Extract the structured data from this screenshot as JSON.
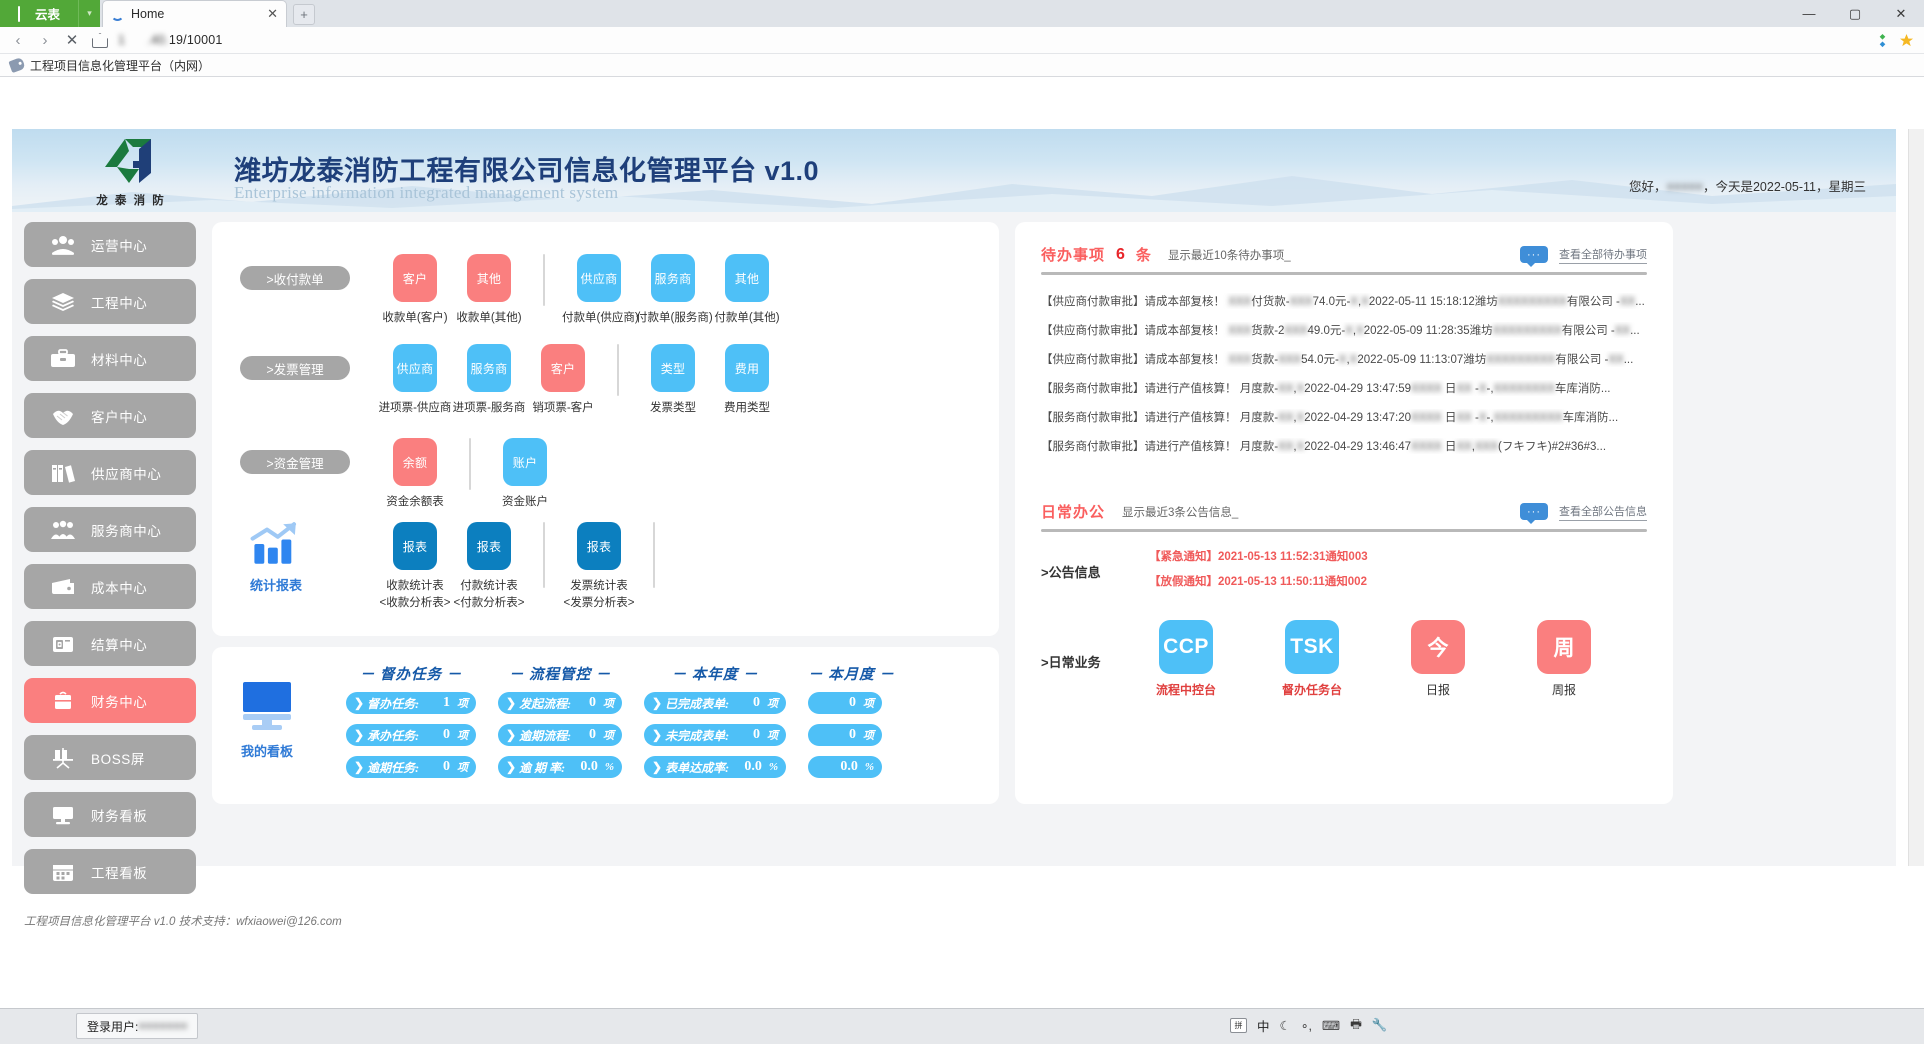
{
  "browser": {
    "brand": "云表",
    "tab_title": "Home",
    "tab_close": "✕",
    "newtab": "+",
    "url": "1      .40.19/10001",
    "bookmark": "工程项目信息化管理平台（内网）",
    "win_minimize": "—",
    "win_maximize": "▢",
    "win_close": "✕"
  },
  "banner": {
    "title": "潍坊龙泰消防工程有限公司信息化管理平台 v1.0",
    "subtitle": "Enterprise information integrated management system",
    "logo_sub": "龙 泰 消 防",
    "greeting_prefix": "您好，",
    "greeting_user": "×××××",
    "greeting_suffix": "，今天是2022-05-11，星期三"
  },
  "sidebar": {
    "items": [
      {
        "label": "运营中心",
        "icon": "team-icon",
        "active": false
      },
      {
        "label": "工程中心",
        "icon": "layers-icon",
        "active": false
      },
      {
        "label": "材料中心",
        "icon": "toolbox-icon",
        "active": false
      },
      {
        "label": "客户中心",
        "icon": "handshake-icon",
        "active": false
      },
      {
        "label": "供应商中心",
        "icon": "books-icon",
        "active": false
      },
      {
        "label": "服务商中心",
        "icon": "people-icon",
        "active": false
      },
      {
        "label": "成本中心",
        "icon": "wallet-icon",
        "active": false
      },
      {
        "label": "结算中心",
        "icon": "card-icon",
        "active": false
      },
      {
        "label": "财务中心",
        "icon": "briefcase-icon",
        "active": true
      },
      {
        "label": "BOSS屏",
        "icon": "presentation-icon",
        "active": false
      },
      {
        "label": "财务看板",
        "icon": "monitor-icon",
        "active": false
      },
      {
        "label": "工程看板",
        "icon": "calendar-icon",
        "active": false
      }
    ]
  },
  "main": {
    "groups": [
      {
        "pill": ">收付款单",
        "tiles": [
          {
            "badge": "客户",
            "color": "red",
            "label": "收款单(客户)"
          },
          {
            "badge": "其他",
            "color": "red",
            "label": "收款单(其他)"
          },
          {
            "divider": true
          },
          {
            "badge": "供应商",
            "color": "blue",
            "label": "付款单(供应商)"
          },
          {
            "badge": "服务商",
            "color": "blue",
            "label": "付款单(服务商)"
          },
          {
            "badge": "其他",
            "color": "blue",
            "label": "付款单(其他)"
          }
        ]
      },
      {
        "pill": ">发票管理",
        "tiles": [
          {
            "badge": "供应商",
            "color": "blue",
            "label": "进项票-供应商"
          },
          {
            "badge": "服务商",
            "color": "blue",
            "label": "进项票-服务商"
          },
          {
            "badge": "客户",
            "color": "red",
            "label": "销项票-客户"
          },
          {
            "divider": true
          },
          {
            "badge": "类型",
            "color": "blue",
            "label": "发票类型"
          },
          {
            "badge": "费用",
            "color": "blue",
            "label": "费用类型"
          }
        ]
      },
      {
        "pill": ">资金管理",
        "tiles": [
          {
            "badge": "余额",
            "color": "red",
            "label": "资金余额表"
          },
          {
            "divider": true
          },
          {
            "badge": "账户",
            "color": "blue",
            "label": "资金账户"
          }
        ]
      }
    ],
    "report": {
      "left_label": "统计报表",
      "tiles": [
        {
          "badge": "报表",
          "color": "dblue",
          "label": "收款统计表",
          "label2": "<收款分析表>"
        },
        {
          "badge": "报表",
          "color": "dblue",
          "label": "付款统计表",
          "label2": "<付款分析表>"
        },
        {
          "divider": true
        },
        {
          "badge": "报表",
          "color": "dblue",
          "label": "发票统计表",
          "label2": "<发票分析表>"
        },
        {
          "divider": true
        }
      ]
    }
  },
  "board": {
    "left_label": "我的看板",
    "columns": [
      {
        "head": "－ 督办任务 －",
        "rows": [
          {
            "label": "督办任务:",
            "value": "1",
            "unit": "项"
          },
          {
            "label": "承办任务:",
            "value": "0",
            "unit": "项"
          },
          {
            "label": "逾期任务:",
            "value": "0",
            "unit": "项"
          }
        ]
      },
      {
        "head": "－ 流程管控 －",
        "rows": [
          {
            "label": "发起流程:",
            "value": "0",
            "unit": "项"
          },
          {
            "label": "逾期流程:",
            "value": "0",
            "unit": "项"
          },
          {
            "label": "逾 期 率:",
            "value": "0.0",
            "unit": "%"
          }
        ]
      },
      {
        "head": "－ 本年度 －",
        "rows": [
          {
            "label": "已完成表单:",
            "value": "0",
            "unit": "项"
          },
          {
            "label": "未完成表单:",
            "value": "0",
            "unit": "项"
          },
          {
            "label": "表单达成率:",
            "value": "0.0",
            "unit": "%"
          }
        ]
      },
      {
        "head": "－ 本月度 －",
        "rows": [
          {
            "value": "0",
            "unit": "项"
          },
          {
            "value": "0",
            "unit": "项"
          },
          {
            "value": "0.0",
            "unit": "%"
          }
        ]
      }
    ]
  },
  "right": {
    "todo": {
      "title": "待办事项",
      "count": "6",
      "unit": "条",
      "note": "显示最近10条待办事项_",
      "msg_icon": "···",
      "more_link": "查看全部待办事项",
      "items": [
        "【供应商付款审批】请成本部复核！ ███付货款-███74.0元-█,█2022-05-11 15:18:12潍坊█████████有限公司 -██...",
        "【供应商付款审批】请成本部复核！ ███货款-2███49.0元-█,█2022-05-09 11:28:35潍坊█████████有限公司 -██...",
        "【供应商付款审批】请成本部复核！ ███货款-███54.0元-█,█2022-05-09 11:13:07潍坊█████████有限公司 -██...",
        "【服务商付款审批】请进行产值核算！ 月度款-██,█2022-04-29 13:47:59████ 日██ -█-,████████车库消防...",
        "【服务商付款审批】请进行产值核算！ 月度款-██,█2022-04-29 13:47:20████ 日██ -█-,█████████车库消防...",
        "【服务商付款审批】请进行产值核算！ 月度款-██,█2022-04-29 13:46:47████ 日██,███(フキフキ)#2#36#3..."
      ]
    },
    "office": {
      "title": "日常办公",
      "note": "显示最近3条公告信息_",
      "msg_icon": "···",
      "more_link": "查看全部公告信息",
      "notice_label": ">公告信息",
      "notices": [
        "【紧急通知】2021-05-13 11:52:31通知003",
        "【放假通知】2021-05-13 11:50:11通知002"
      ],
      "biz_label": ">日常业务",
      "biz": [
        {
          "badge": "CCP",
          "color": "lb",
          "name": "流程中控台",
          "red": true
        },
        {
          "badge": "TSK",
          "color": "lb",
          "name": "督办任务台",
          "red": true
        },
        {
          "badge": "今",
          "color": "red",
          "name": "日报",
          "red": false
        },
        {
          "badge": "周",
          "color": "red",
          "name": "周报",
          "red": false
        }
      ]
    }
  },
  "footer": {
    "text": "工程项目信息化管理平台 v1.0    技术支持：wfxiaowei@126.com"
  },
  "taskbar": {
    "login_label": "登录用户:",
    "login_user": "×××××××",
    "ime_glyph": "拼",
    "ime_label": "中",
    "tray_moon": "☾",
    "tray_dots": "∘,",
    "tray_kb": "⌨",
    "tray_print": "🖶",
    "tray_tool": "🔧"
  }
}
